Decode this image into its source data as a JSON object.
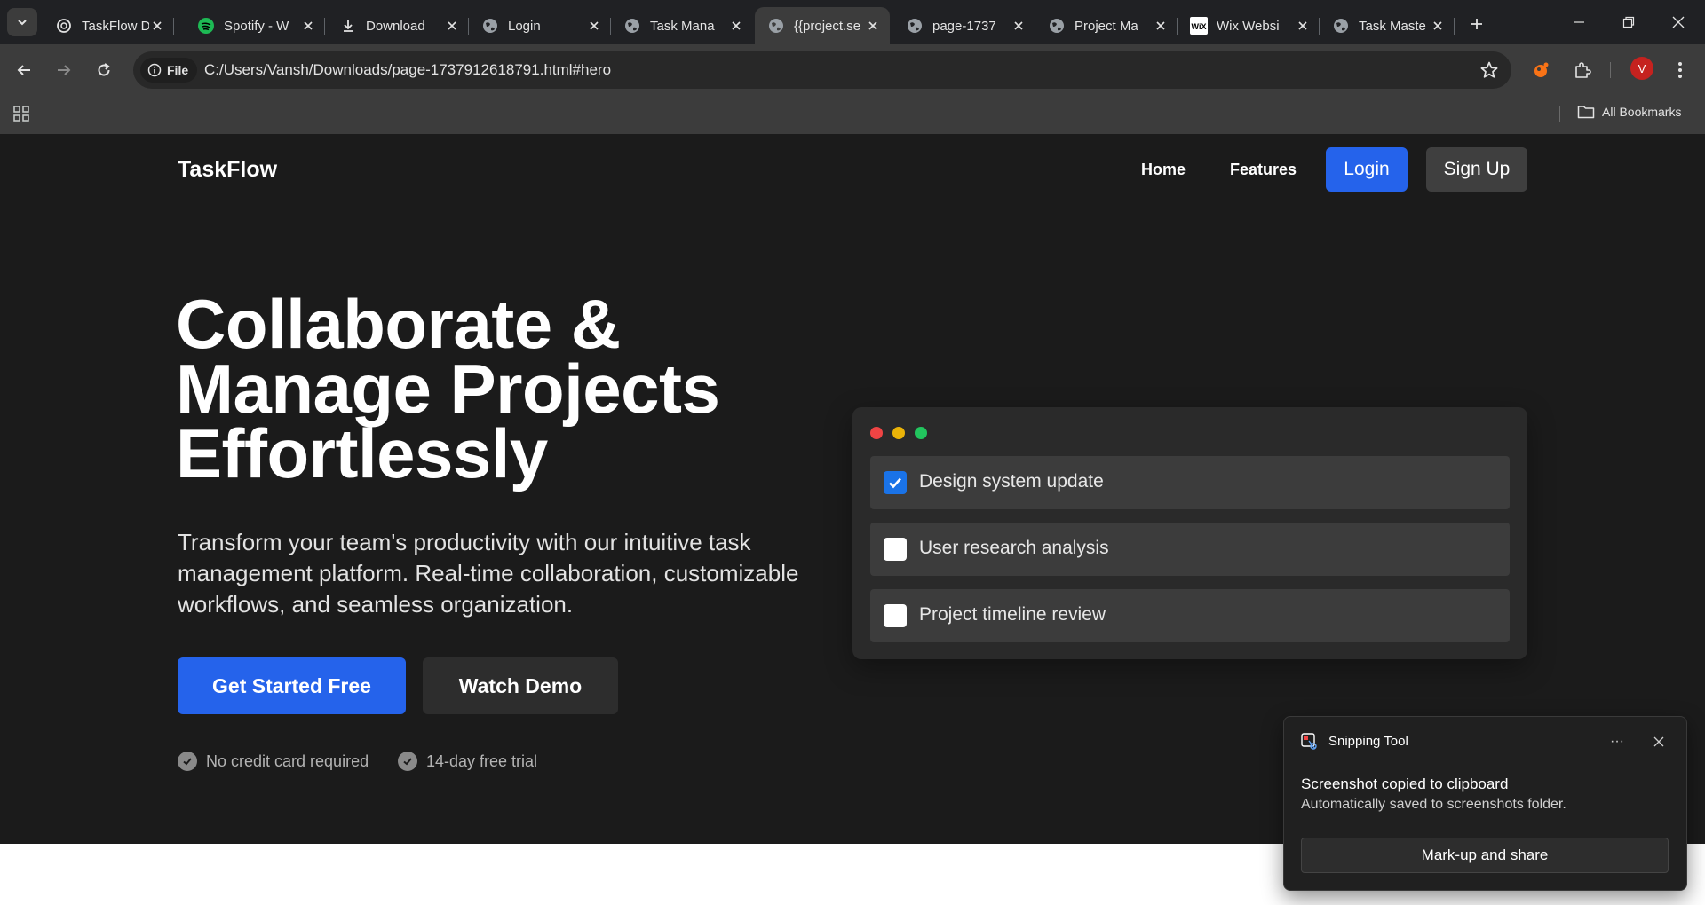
{
  "browser": {
    "tabs": [
      {
        "title": "TaskFlow D",
        "icon": "openai-icon"
      },
      {
        "title": "Spotify - W",
        "icon": "spotify-icon"
      },
      {
        "title": "Download",
        "icon": "download-icon"
      },
      {
        "title": "Login",
        "icon": "globe-icon"
      },
      {
        "title": "Task Mana",
        "icon": "globe-icon"
      },
      {
        "title": "{{project.se",
        "icon": "globe-icon",
        "active": true
      },
      {
        "title": "page-1737",
        "icon": "globe-icon"
      },
      {
        "title": "Project Ma",
        "icon": "globe-icon"
      },
      {
        "title": "Wix Websi",
        "icon": "wix-icon"
      },
      {
        "title": "Task Maste",
        "icon": "globe-icon"
      }
    ],
    "address": {
      "chip_label": "File",
      "url": "C:/Users/Vansh/Downloads/page-1737912618791.html#hero"
    },
    "profile_initial": "V",
    "bookmarks_label": "All Bookmarks",
    "colors": {
      "chrome": "#3c3c3c",
      "tabstrip": "#202124",
      "profile": "#c5221f"
    }
  },
  "site": {
    "brand": "TaskFlow",
    "nav": {
      "home": "Home",
      "features": "Features",
      "login": "Login",
      "signup": "Sign Up"
    },
    "hero": {
      "title_lines": [
        "Collaborate &",
        "Manage Projects",
        "Effortlessly"
      ],
      "subtitle": "Transform your team's productivity with our intuitive task management platform. Real-time collaboration, customizable workflows, and seamless organization.",
      "primary_cta": "Get Started Free",
      "secondary_cta": "Watch Demo",
      "perks": [
        "No credit card required",
        "14-day free trial"
      ]
    },
    "preview": {
      "tasks": [
        {
          "label": "Design system update",
          "checked": true
        },
        {
          "label": "User research analysis",
          "checked": false
        },
        {
          "label": "Project timeline review",
          "checked": false
        }
      ],
      "dot_colors": [
        "#ef4444",
        "#eab308",
        "#22c55e"
      ]
    },
    "colors": {
      "accent": "#2563eb",
      "background": "#1b1b1b"
    }
  },
  "notification": {
    "app": "Snipping Tool",
    "title": "Screenshot copied to clipboard",
    "body": "Automatically saved to screenshots folder.",
    "action": "Mark-up and share",
    "more": "···"
  }
}
